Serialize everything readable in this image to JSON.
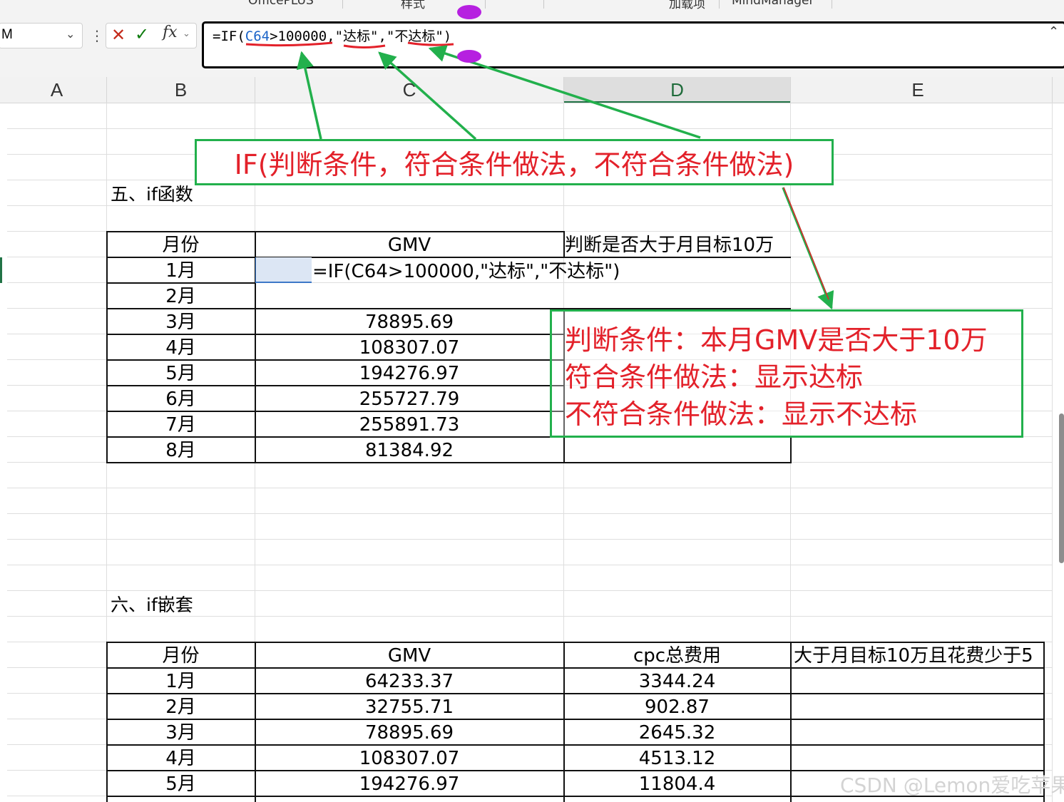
{
  "ribbon": {
    "groups": [
      "OfficePLUS",
      "样式",
      "加载项",
      "MindManager"
    ]
  },
  "formula_bar": {
    "name_box": "M",
    "formula_parts": {
      "p1": "=IF(",
      "ref": "C64",
      "p2": ">100000,\"达标\",\"不达标\")"
    }
  },
  "columns": [
    "A",
    "B",
    "C",
    "D",
    "E"
  ],
  "section1": {
    "heading": "五、if函数",
    "headers": {
      "month": "月份",
      "gmv": "GMV",
      "judge": "判断是否大于月目标10万"
    },
    "rows": [
      {
        "month": "1月",
        "gmv": ""
      },
      {
        "month": "2月",
        "gmv": ""
      },
      {
        "month": "3月",
        "gmv": "78895.69"
      },
      {
        "month": "4月",
        "gmv": "108307.07"
      },
      {
        "month": "5月",
        "gmv": "194276.97"
      },
      {
        "month": "6月",
        "gmv": "255727.79"
      },
      {
        "month": "7月",
        "gmv": "255891.73"
      },
      {
        "month": "8月",
        "gmv": "81384.92"
      }
    ],
    "editing_formula": "=IF(C64>100000,\"达标\",\"不达标\")"
  },
  "section2": {
    "heading": "六、if嵌套",
    "headers": {
      "month": "月份",
      "gmv": "GMV",
      "cpc": "cpc总费用",
      "cond": "大于月目标10万且花费少于5"
    },
    "rows": [
      {
        "month": "1月",
        "gmv": "64233.37",
        "cpc": "3344.24"
      },
      {
        "month": "2月",
        "gmv": "32755.71",
        "cpc": "902.87"
      },
      {
        "month": "3月",
        "gmv": "78895.69",
        "cpc": "2645.32"
      },
      {
        "month": "4月",
        "gmv": "108307.07",
        "cpc": "4513.12"
      },
      {
        "month": "5月",
        "gmv": "194276.97",
        "cpc": "11804.4"
      }
    ]
  },
  "annotations": {
    "syntax": "IF(判断条件，符合条件做法，不符合条件做法)",
    "line1": "判断条件：本月GMV是否大于10万",
    "line2": "符合条件做法：显示达标",
    "line3": "不符合条件做法：显示不达标"
  },
  "watermark": "CSDN @Lemon爱吃苹果",
  "colors": {
    "annotation_red": "#e3212a",
    "annotation_green": "#22b04c",
    "excel_green": "#217346"
  }
}
